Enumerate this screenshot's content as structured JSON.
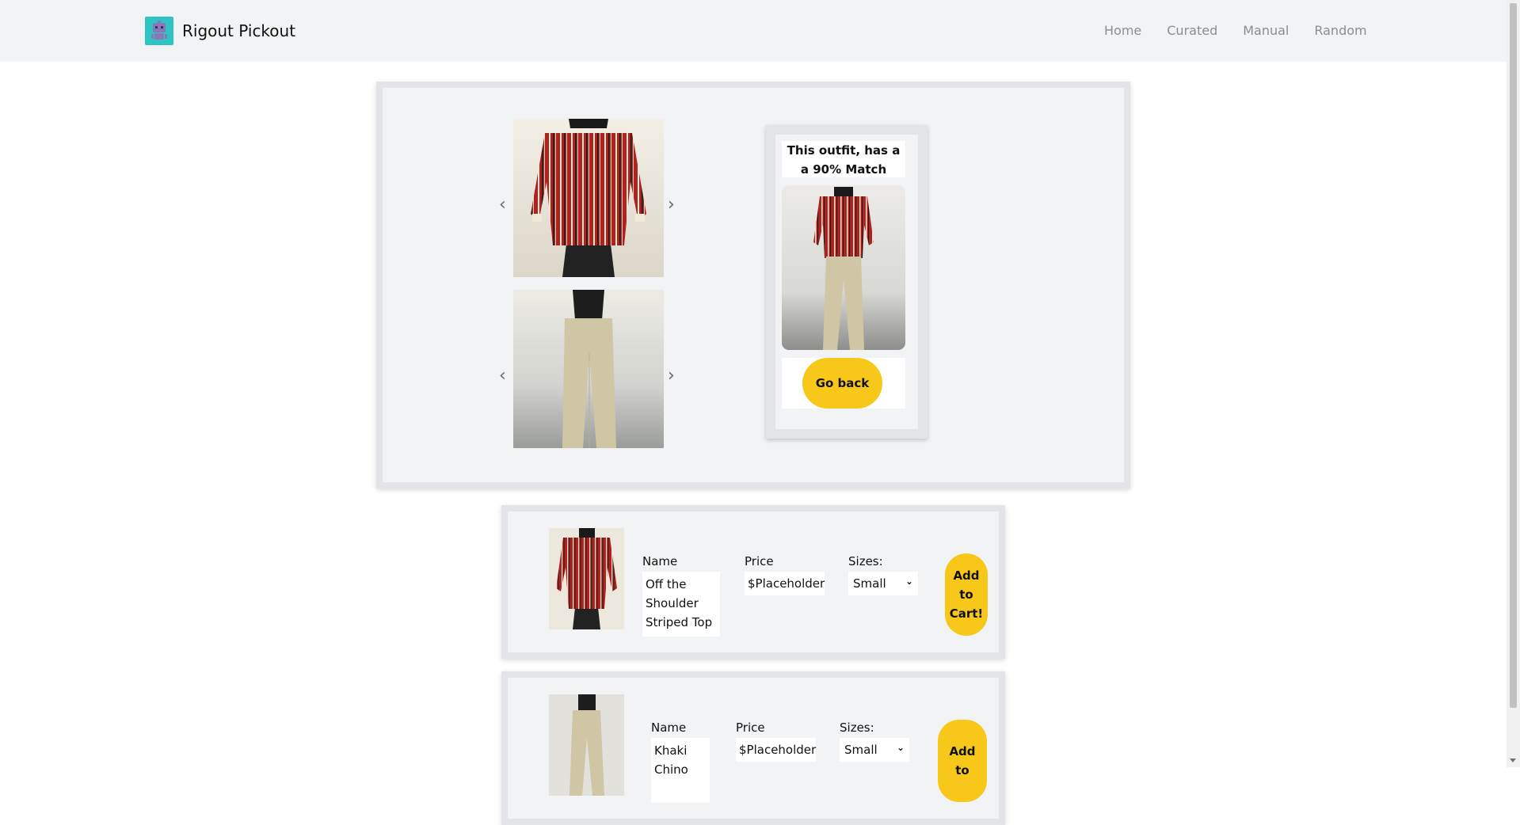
{
  "brand": {
    "title": "Rigout Pickout",
    "logo_icon": "robot-icon"
  },
  "nav": {
    "items": [
      "Home",
      "Curated",
      "Manual",
      "Random"
    ]
  },
  "carousel": {
    "top_image": "red-striped-top-photo",
    "bottom_image": "khaki-chinos-photo"
  },
  "match": {
    "text_line1": "This outfit, has a",
    "text_line2": "a 90% Match",
    "go_back_label": "Go back"
  },
  "products": [
    {
      "name_label": "Name",
      "name_line1": "Off the",
      "name_line2": "Shoulder",
      "name_line3": "Striped Top",
      "price_label": "Price",
      "price": "$Placeholder",
      "sizes_label": "Sizes:",
      "size_selected": "Small",
      "add_label_1": "Add",
      "add_label_2": "to",
      "add_label_3": "Cart!"
    },
    {
      "name_label": "Name",
      "name_line1": "Khaki",
      "name_line2": "Chino",
      "price_label": "Price",
      "price": "$Placeholder",
      "sizes_label": "Sizes:",
      "size_selected": "Small",
      "add_label_1": "Add",
      "add_label_2": "to"
    }
  ],
  "colors": {
    "accent_yellow": "#f7c71a",
    "logo_teal": "#2ec4c4",
    "panel_bg": "#f2f3f4",
    "panel_border": "#e3e4e8"
  }
}
